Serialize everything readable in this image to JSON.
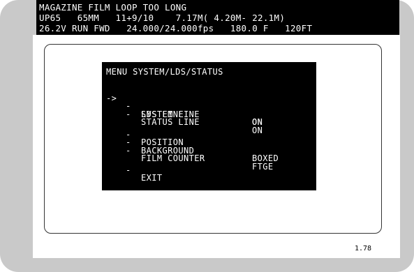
{
  "status": {
    "line1": "MAGAZINE FILM LOOP TOO LONG",
    "line2": "UP65   65MM   11+9/10    7.17M( 4.20M- 22.1M)",
    "line3": "26.2V RUN FWD   24.000/24.000fps   180.0 F   120FT"
  },
  "menu": {
    "title": "MENU SYSTEM/LDS/STATUS",
    "cursor": "->",
    "items": [
      {
        "dash": "-",
        "label": "SYSTEM LINE",
        "value": "ON"
      },
      {
        "dash": "-",
        "label": "LDS LINE",
        "value": "ON"
      },
      {
        "dash": "-",
        "label": "STATUS LINE",
        "value": "ON"
      },
      {
        "dash": "-",
        "label": "POSITION",
        "value": ""
      },
      {
        "dash": "-",
        "label": "BACKGROUND",
        "value": "BOXED"
      },
      {
        "dash": "-",
        "label": "FILM COUNTER",
        "value": "FTGE"
      },
      {
        "dash": "-",
        "label": "EXIT",
        "value": ""
      }
    ]
  },
  "version": "1.78"
}
